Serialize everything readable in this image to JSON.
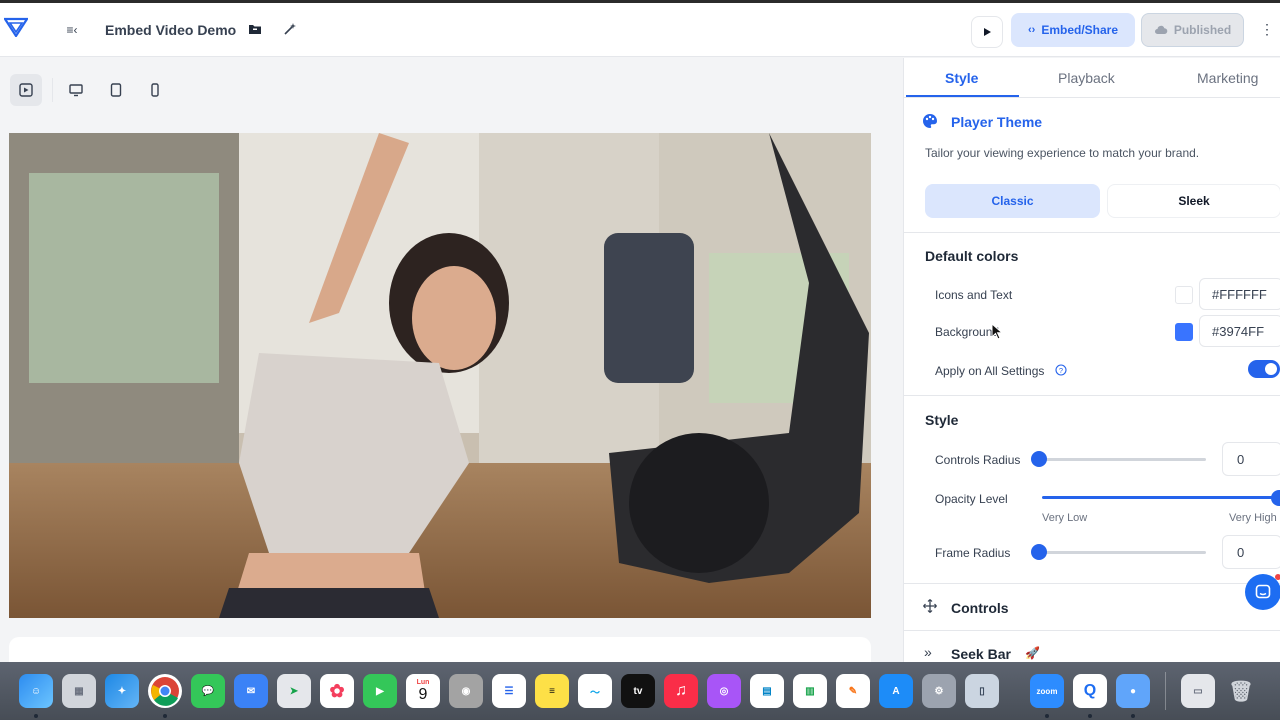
{
  "header": {
    "title": "Embed Video Demo",
    "collapse_icon": "collapse-sidebar-icon",
    "embed_label": "Embed/Share",
    "published_label": "Published",
    "more_label": "⋮"
  },
  "view_toolbar": {
    "items": [
      "preview-icon",
      "desktop-icon",
      "tablet-icon",
      "mobile-icon"
    ]
  },
  "panel": {
    "tabs": [
      "Style",
      "Playback",
      "Marketing"
    ],
    "active_tab": "Style",
    "player_theme": {
      "title": "Player Theme",
      "subtitle": "Tailor your viewing experience to match your brand.",
      "options": [
        "Classic",
        "Sleek"
      ],
      "selected": "Classic"
    },
    "default_colors": {
      "title": "Default colors",
      "icons_label": "Icons and Text",
      "icons_value": "#FFFFFF",
      "background_label": "Background",
      "background_value": "#3974FF",
      "apply_label": "Apply on All Settings",
      "apply_on": true
    },
    "style": {
      "title": "Style",
      "controls_radius_label": "Controls Radius",
      "controls_radius_value": "0",
      "opacity_label": "Opacity Level",
      "opacity_low": "Very Low",
      "opacity_high": "Very High",
      "frame_radius_label": "Frame Radius",
      "frame_radius_value": "0"
    },
    "controls_title": "Controls",
    "seek_bar_title": "Seek Bar"
  },
  "colors": {
    "accent": "#2563eb",
    "accent_soft": "#dbe6fd",
    "background_swatch": "#3974FF"
  },
  "dock": {
    "calendar_month": "Lun",
    "calendar_day": "9",
    "tv_label": "tv",
    "zoom_label": "zoom"
  }
}
